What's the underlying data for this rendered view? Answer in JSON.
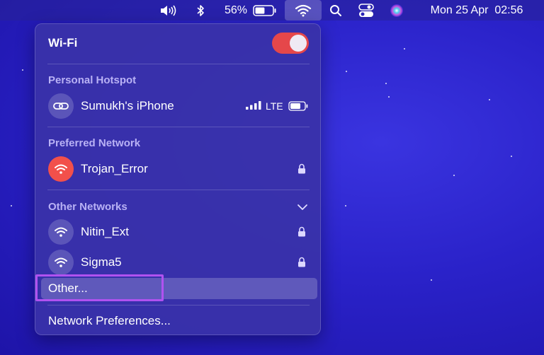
{
  "menubar": {
    "volume_icon": "speaker-icon",
    "bluetooth_icon": "bluetooth-icon",
    "battery_percent": "56%",
    "battery_level": 0.56,
    "wifi_icon": "wifi-icon",
    "search_icon": "search-icon",
    "control_center_icon": "control-center-icon",
    "siri_icon": "siri-icon",
    "clock": "Mon 25 Apr  02:56"
  },
  "wifi_menu": {
    "title": "Wi-Fi",
    "toggle_on": true,
    "toggle_color": "#e5474a",
    "personal_hotspot": {
      "header": "Personal Hotspot",
      "device": "Sumukh's iPhone",
      "network_type": "LTE",
      "signal_bars": 4
    },
    "preferred": {
      "header": "Preferred Network",
      "network": "Trojan_Error",
      "accent": "#f2504b"
    },
    "other_networks": {
      "header": "Other Networks",
      "networks": [
        {
          "name": "Nitin_Ext"
        },
        {
          "name": "Sigma5"
        }
      ]
    },
    "other_label": "Other...",
    "network_preferences_label": "Network Preferences..."
  }
}
